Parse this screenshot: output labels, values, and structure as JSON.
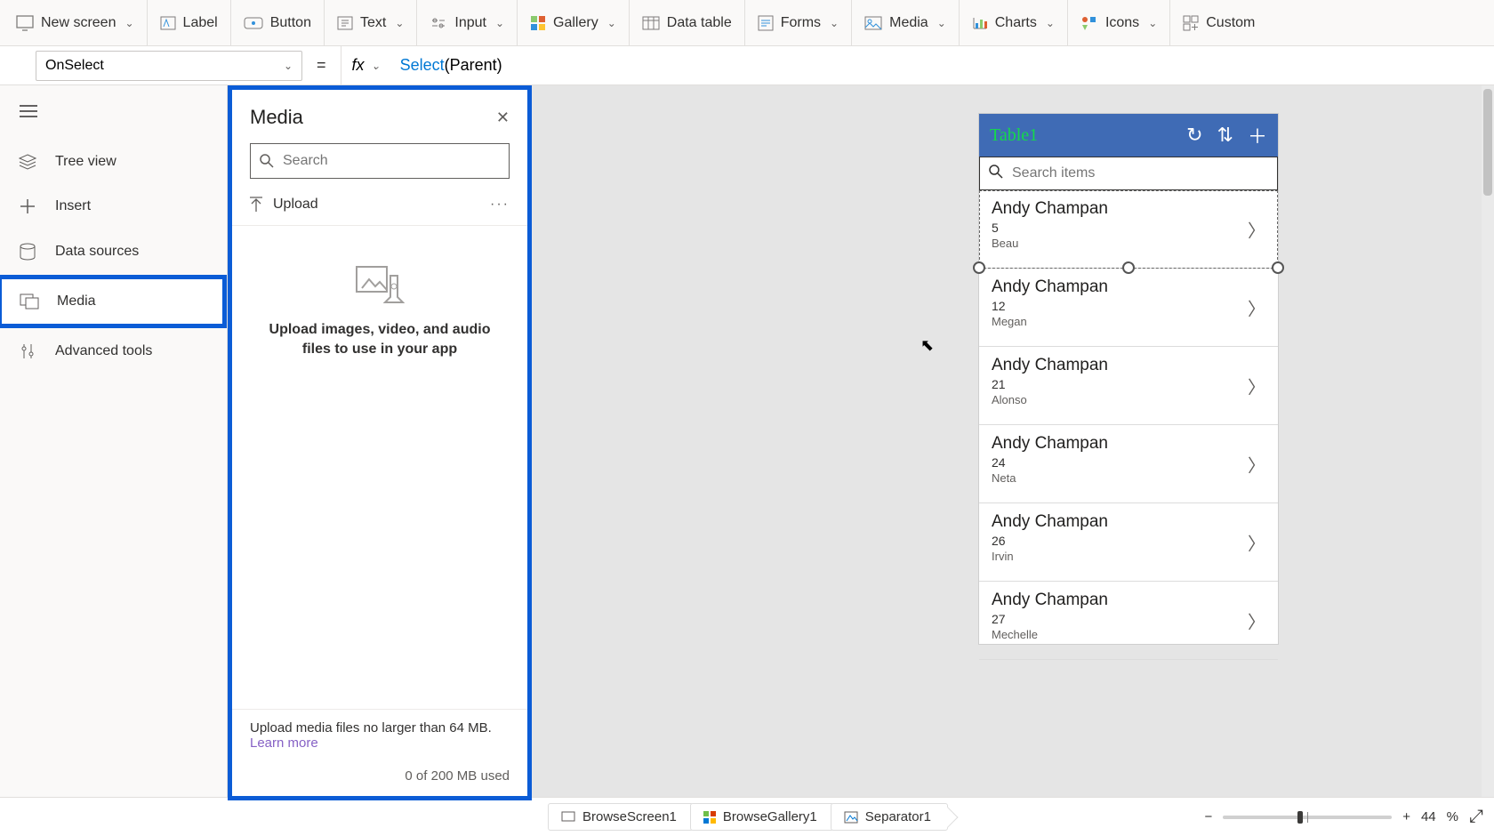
{
  "ribbon": [
    {
      "label": "New screen",
      "chev": true
    },
    {
      "label": "Label"
    },
    {
      "label": "Button"
    },
    {
      "label": "Text",
      "chev": true
    },
    {
      "label": "Input",
      "chev": true
    },
    {
      "label": "Gallery",
      "chev": true
    },
    {
      "label": "Data table"
    },
    {
      "label": "Forms",
      "chev": true
    },
    {
      "label": "Media",
      "chev": true
    },
    {
      "label": "Charts",
      "chev": true
    },
    {
      "label": "Icons",
      "chev": true
    },
    {
      "label": "Custom"
    }
  ],
  "formula": {
    "property": "OnSelect",
    "fn": "Select",
    "rest": "(Parent)"
  },
  "rail": [
    {
      "label": "Tree view"
    },
    {
      "label": "Insert"
    },
    {
      "label": "Data sources"
    },
    {
      "label": "Media",
      "active": true
    },
    {
      "label": "Advanced tools"
    }
  ],
  "media": {
    "title": "Media",
    "search_placeholder": "Search",
    "upload_label": "Upload",
    "empty_text": "Upload images, video, and audio files to use in your app",
    "footer_text": "Upload media files no larger than 64 MB.",
    "learn_more": "Learn more",
    "usage": "0 of 200 MB used"
  },
  "phone": {
    "title": "Table1",
    "search_placeholder": "Search items",
    "items": [
      {
        "name": "Andy Champan",
        "num": "5",
        "sub": "Beau",
        "selected": true
      },
      {
        "name": "Andy Champan",
        "num": "12",
        "sub": "Megan"
      },
      {
        "name": "Andy Champan",
        "num": "21",
        "sub": "Alonso"
      },
      {
        "name": "Andy Champan",
        "num": "24",
        "sub": "Neta"
      },
      {
        "name": "Andy Champan",
        "num": "26",
        "sub": "Irvin"
      },
      {
        "name": "Andy Champan",
        "num": "27",
        "sub": "Mechelle"
      }
    ]
  },
  "breadcrumbs": [
    "BrowseScreen1",
    "BrowseGallery1",
    "Separator1"
  ],
  "zoom": {
    "value": "44",
    "pct": "%"
  }
}
